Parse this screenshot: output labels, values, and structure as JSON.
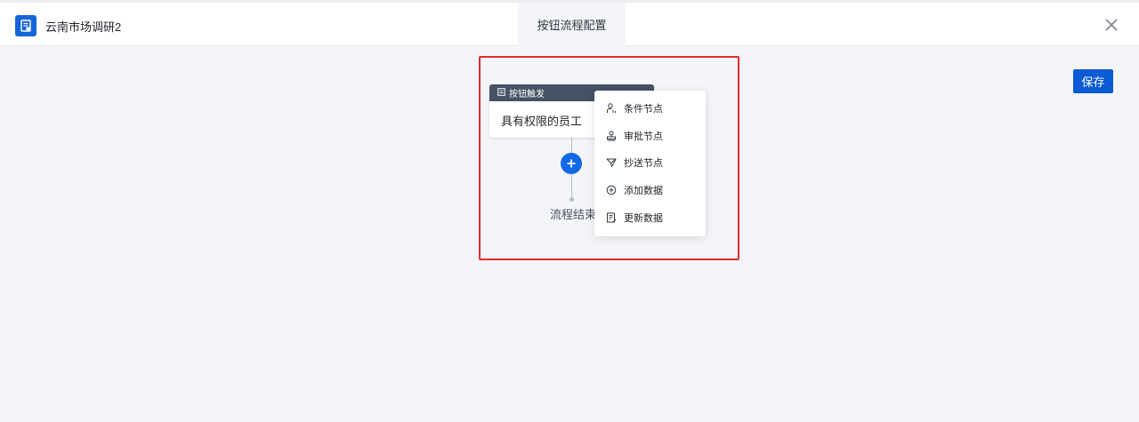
{
  "header": {
    "app_title": "云南市场调研2",
    "center_tab": "按钮流程配置",
    "app_icon": "form-app-icon",
    "close_icon": "close-icon"
  },
  "toolbar": {
    "save_label": "保存"
  },
  "flow": {
    "trigger_title": "按钮触发",
    "trigger_icon": "form-icon",
    "trigger_desc": "具有权限的员工",
    "add_icon": "plus-icon",
    "end_label": "流程结束"
  },
  "menu": {
    "items": [
      {
        "label": "条件节点",
        "icon": "condition-node-icon"
      },
      {
        "label": "审批节点",
        "icon": "stamp-icon"
      },
      {
        "label": "抄送节点",
        "icon": "send-icon"
      },
      {
        "label": "添加数据",
        "icon": "plus-circle-icon"
      },
      {
        "label": "更新数据",
        "icon": "document-edit-icon"
      }
    ]
  },
  "colors": {
    "accent": "#1269e6",
    "save_button": "#0c5ad4",
    "trigger_header": "#465264",
    "highlight_border": "#e02b2b",
    "background": "#f3f5f9"
  }
}
